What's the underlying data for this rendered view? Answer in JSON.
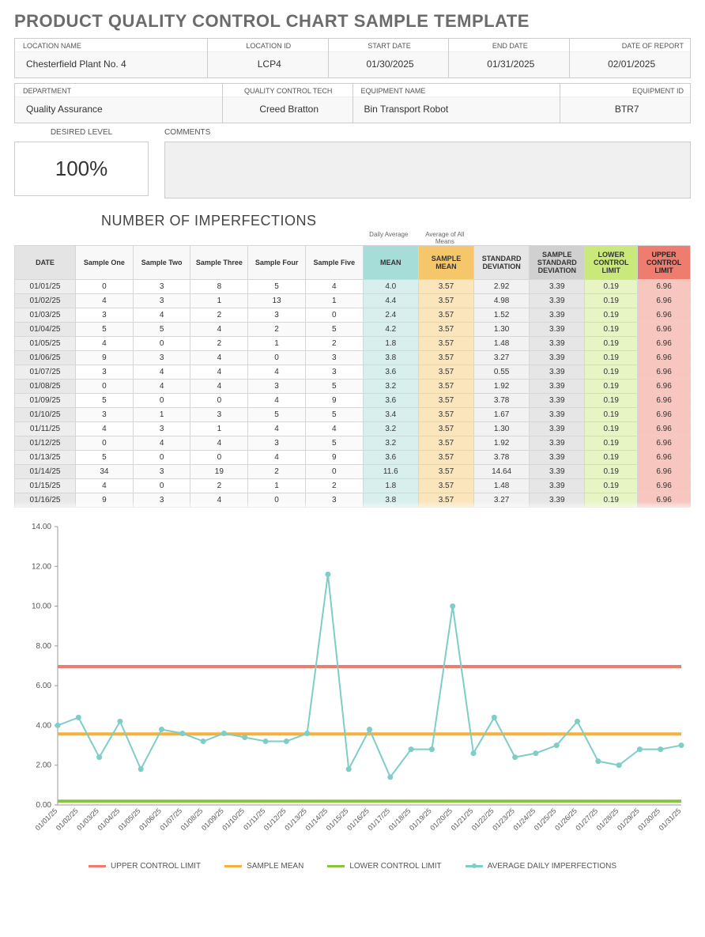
{
  "title": "PRODUCT QUALITY CONTROL CHART SAMPLE TEMPLATE",
  "header1": {
    "loc_name_label": "LOCATION NAME",
    "loc_name": "Chesterfield Plant No. 4",
    "loc_id_label": "LOCATION ID",
    "loc_id": "LCP4",
    "start_label": "START DATE",
    "start": "01/30/2025",
    "end_label": "END DATE",
    "end": "01/31/2025",
    "report_label": "DATE OF REPORT",
    "report": "02/01/2025"
  },
  "header2": {
    "dept_label": "DEPARTMENT",
    "dept": "Quality Assurance",
    "qct_label": "QUALITY CONTROL TECH",
    "qct": "Creed Bratton",
    "equip_label": "EQUIPMENT NAME",
    "equip": "Bin Transport Robot",
    "eid_label": "EQUIPMENT ID",
    "eid": "BTR7"
  },
  "desired": {
    "label": "DESIRED LEVEL",
    "value": "100%"
  },
  "comments": {
    "label": "COMMENTS",
    "value": ""
  },
  "section_title": "NUMBER OF IMPERFECTIONS",
  "subhead_daily": "Daily Average",
  "subhead_allmeans": "Average of All Means",
  "columns": {
    "date": "DATE",
    "s1": "Sample One",
    "s2": "Sample Two",
    "s3": "Sample Three",
    "s4": "Sample Four",
    "s5": "Sample Five",
    "mean": "MEAN",
    "smean": "SAMPLE MEAN",
    "std": "STANDARD DEVIATION",
    "sstd": "SAMPLE STANDARD DEVIATION",
    "lcl": "LOWER CONTROL LIMIT",
    "ucl": "UPPER CONTROL LIMIT"
  },
  "rows": [
    {
      "date": "01/01/25",
      "s": [
        0,
        3,
        8,
        5,
        4
      ],
      "mean": "4.0",
      "std": "2.92"
    },
    {
      "date": "01/02/25",
      "s": [
        4,
        3,
        1,
        13,
        1
      ],
      "mean": "4.4",
      "std": "4.98"
    },
    {
      "date": "01/03/25",
      "s": [
        3,
        4,
        2,
        3,
        0
      ],
      "mean": "2.4",
      "std": "1.52"
    },
    {
      "date": "01/04/25",
      "s": [
        5,
        5,
        4,
        2,
        5
      ],
      "mean": "4.2",
      "std": "1.30"
    },
    {
      "date": "01/05/25",
      "s": [
        4,
        0,
        2,
        1,
        2
      ],
      "mean": "1.8",
      "std": "1.48"
    },
    {
      "date": "01/06/25",
      "s": [
        9,
        3,
        4,
        0,
        3
      ],
      "mean": "3.8",
      "std": "3.27"
    },
    {
      "date": "01/07/25",
      "s": [
        3,
        4,
        4,
        4,
        3
      ],
      "mean": "3.6",
      "std": "0.55"
    },
    {
      "date": "01/08/25",
      "s": [
        0,
        4,
        4,
        3,
        5
      ],
      "mean": "3.2",
      "std": "1.92"
    },
    {
      "date": "01/09/25",
      "s": [
        5,
        0,
        0,
        4,
        9
      ],
      "mean": "3.6",
      "std": "3.78"
    },
    {
      "date": "01/10/25",
      "s": [
        3,
        1,
        3,
        5,
        5
      ],
      "mean": "3.4",
      "std": "1.67"
    },
    {
      "date": "01/11/25",
      "s": [
        4,
        3,
        1,
        4,
        4
      ],
      "mean": "3.2",
      "std": "1.30"
    },
    {
      "date": "01/12/25",
      "s": [
        0,
        4,
        4,
        3,
        5
      ],
      "mean": "3.2",
      "std": "1.92"
    },
    {
      "date": "01/13/25",
      "s": [
        5,
        0,
        0,
        4,
        9
      ],
      "mean": "3.6",
      "std": "3.78"
    },
    {
      "date": "01/14/25",
      "s": [
        34,
        3,
        19,
        2,
        0
      ],
      "mean": "11.6",
      "std": "14.64"
    },
    {
      "date": "01/15/25",
      "s": [
        4,
        0,
        2,
        1,
        2
      ],
      "mean": "1.8",
      "std": "1.48"
    },
    {
      "date": "01/16/25",
      "s": [
        9,
        3,
        4,
        0,
        3
      ],
      "mean": "3.8",
      "std": "3.27"
    }
  ],
  "constants": {
    "smean": "3.57",
    "sstd": "3.39",
    "lcl": "0.19",
    "ucl": "6.96"
  },
  "legend": {
    "ucl": "UPPER CONTROL LIMIT",
    "smean": "SAMPLE MEAN",
    "lcl": "LOWER CONTROL LIMIT",
    "avg": "AVERAGE DAILY IMPERFECTIONS"
  },
  "chart_data": {
    "type": "line",
    "title": "",
    "xlabel": "",
    "ylabel": "",
    "ylim": [
      0,
      14
    ],
    "yticks": [
      0,
      2,
      4,
      6,
      8,
      10,
      12,
      14
    ],
    "categories": [
      "01/01/25",
      "01/02/25",
      "01/03/25",
      "01/04/25",
      "01/05/25",
      "01/06/25",
      "01/07/25",
      "01/08/25",
      "01/09/25",
      "01/10/25",
      "01/11/25",
      "01/12/25",
      "01/13/25",
      "01/14/25",
      "01/15/25",
      "01/16/25",
      "01/17/25",
      "01/18/25",
      "01/19/25",
      "01/20/25",
      "01/21/25",
      "01/22/25",
      "01/23/25",
      "01/24/25",
      "01/25/25",
      "01/26/25",
      "01/27/25",
      "01/28/25",
      "01/29/25",
      "01/30/25",
      "01/31/25"
    ],
    "series": [
      {
        "name": "UPPER CONTROL LIMIT",
        "type": "hline",
        "value": 6.96,
        "color": "#ed7b6e"
      },
      {
        "name": "SAMPLE MEAN",
        "type": "hline",
        "value": 3.57,
        "color": "#f5b13c"
      },
      {
        "name": "LOWER CONTROL LIMIT",
        "type": "hline",
        "value": 0.19,
        "color": "#8ac43f"
      },
      {
        "name": "AVERAGE DAILY IMPERFECTIONS",
        "type": "line",
        "color": "#7ecdc6",
        "values": [
          4.0,
          4.4,
          2.4,
          4.2,
          1.8,
          3.8,
          3.6,
          3.2,
          3.6,
          3.4,
          3.2,
          3.2,
          3.6,
          11.6,
          1.8,
          3.8,
          1.4,
          2.8,
          2.8,
          10.0,
          2.6,
          4.4,
          2.4,
          2.6,
          3.0,
          4.2,
          2.2,
          2.0,
          2.8,
          2.8,
          3.0
        ]
      }
    ]
  }
}
